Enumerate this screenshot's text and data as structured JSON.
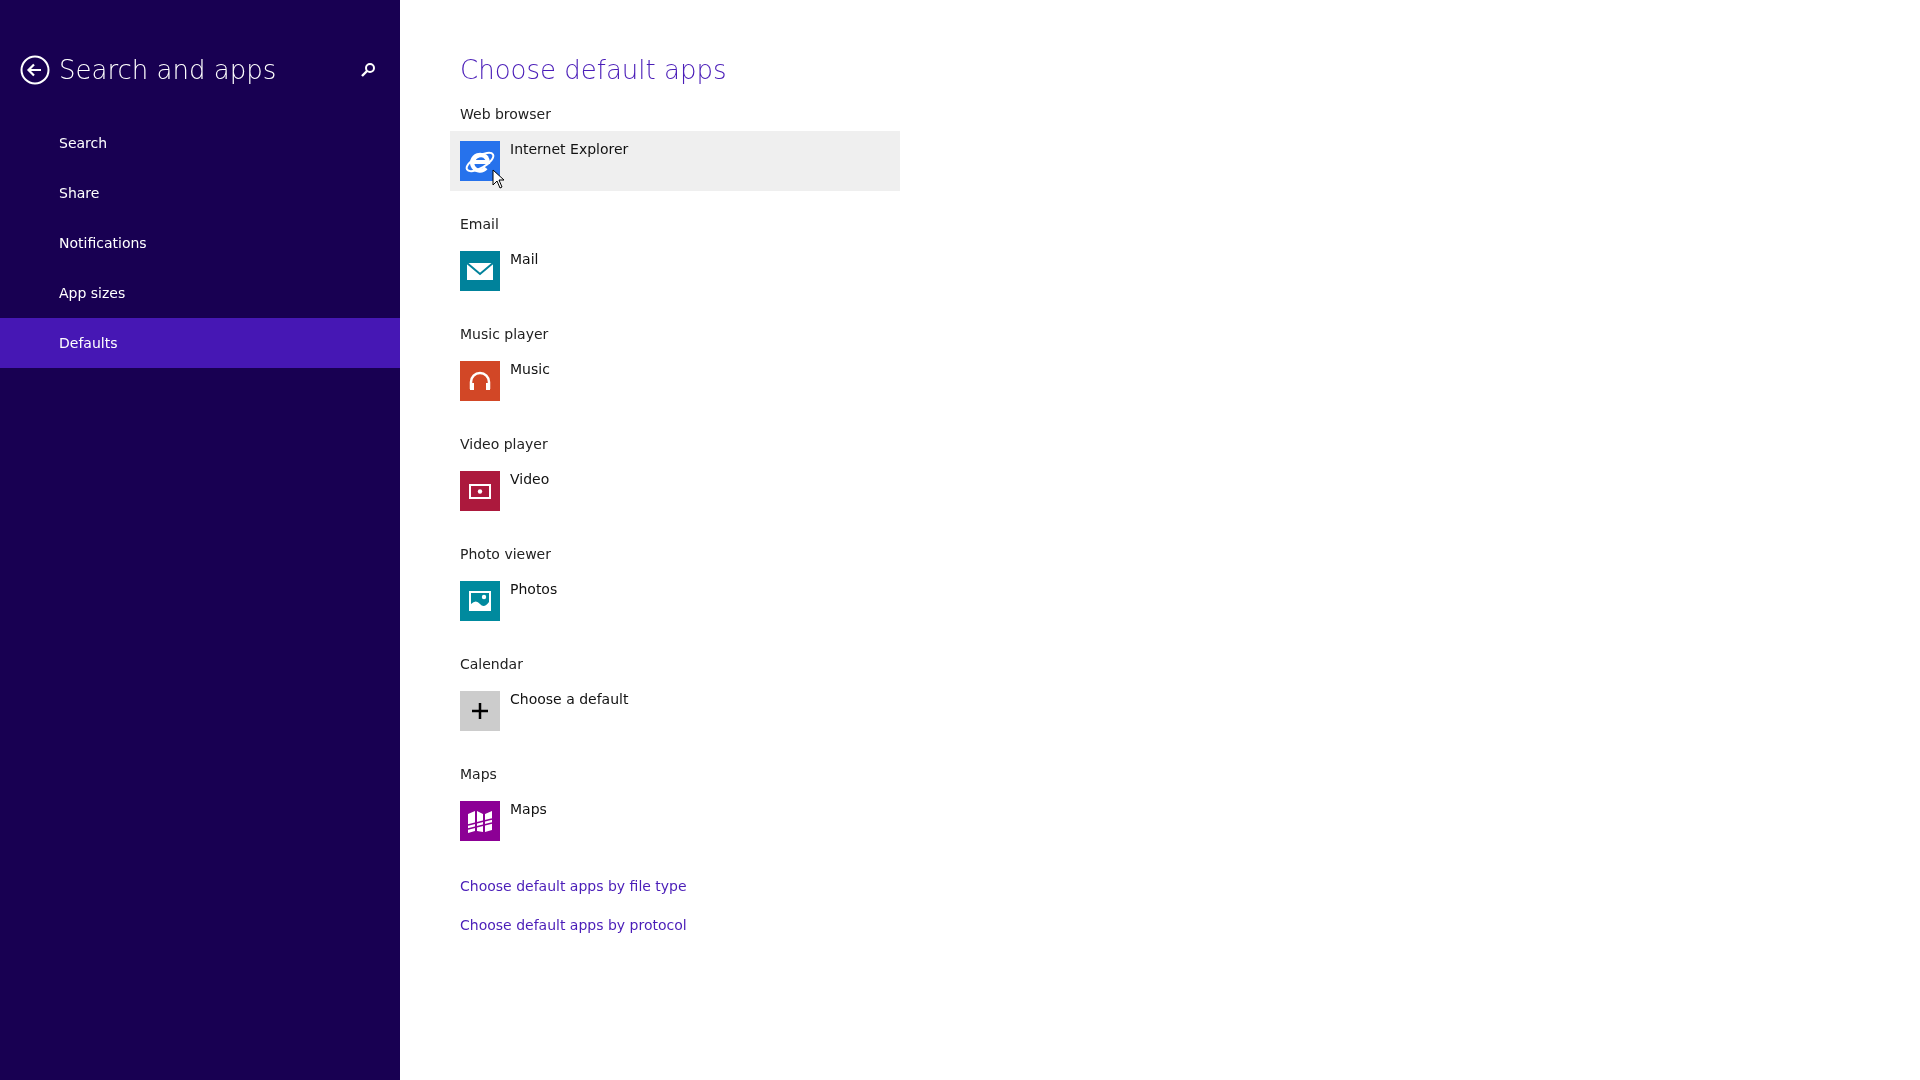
{
  "sidebar": {
    "title": "Search and apps",
    "items": [
      {
        "label": "Search",
        "selected": false
      },
      {
        "label": "Share",
        "selected": false
      },
      {
        "label": "Notifications",
        "selected": false
      },
      {
        "label": "App sizes",
        "selected": false
      },
      {
        "label": "Defaults",
        "selected": true
      }
    ]
  },
  "main": {
    "heading": "Choose default apps",
    "groups": [
      {
        "label": "Web browser",
        "app": "Internet Explorer",
        "kind": "browser",
        "color": "#2672ec",
        "hovered": true
      },
      {
        "label": "Email",
        "app": "Mail",
        "kind": "mail",
        "color": "#00829b",
        "hovered": false
      },
      {
        "label": "Music player",
        "app": "Music",
        "kind": "music",
        "color": "#d24726",
        "hovered": false
      },
      {
        "label": "Video player",
        "app": "Video",
        "kind": "video",
        "color": "#ac193d",
        "hovered": false
      },
      {
        "label": "Photo viewer",
        "app": "Photos",
        "kind": "photos",
        "color": "#008a9e",
        "hovered": false
      },
      {
        "label": "Calendar",
        "app": "Choose a default",
        "kind": "add",
        "color": "#cccccc",
        "hovered": false
      },
      {
        "label": "Maps",
        "app": "Maps",
        "kind": "maps",
        "color": "#8c0095",
        "hovered": false
      }
    ],
    "links": [
      "Choose default apps by file type",
      "Choose default apps by protocol"
    ]
  }
}
